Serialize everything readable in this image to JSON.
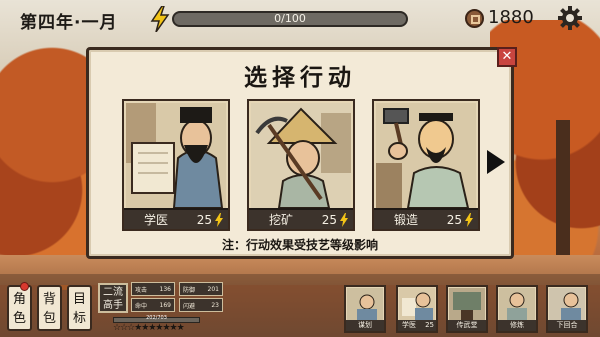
{
  "header": {
    "season": "第四年·一月",
    "energy_text": "0/100",
    "energy_fraction": 0,
    "coins": "1880"
  },
  "dialog": {
    "title": "选择行动",
    "close_label": "✕",
    "note": "注：行动效果受技艺等级影响",
    "cards": [
      {
        "name": "学医",
        "cost": "25"
      },
      {
        "name": "挖矿",
        "cost": "25"
      },
      {
        "name": "锻造",
        "cost": "25"
      }
    ]
  },
  "sidebar": {
    "buttons": [
      {
        "label_top": "角",
        "label_bottom": "色"
      },
      {
        "label_top": "背",
        "label_bottom": "包"
      },
      {
        "label_top": "目",
        "label_bottom": "标"
      }
    ]
  },
  "character": {
    "rank_top": "二流",
    "rank_bottom": "高手",
    "stats": [
      {
        "label": "攻击",
        "value": "136"
      },
      {
        "label": "防御",
        "value": "201"
      },
      {
        "label": "命中",
        "value": "169"
      },
      {
        "label": "闪避",
        "value": "23"
      }
    ],
    "xp_text": "202/703",
    "stars": "☆☆☆★★★★★★★"
  },
  "actions": [
    {
      "label": "谋划"
    },
    {
      "label": "学医",
      "cost": "25"
    },
    {
      "label": "传武堂"
    },
    {
      "label": "修炼"
    },
    {
      "label": "下回合"
    }
  ],
  "colors": {
    "panel": "#f3ead7",
    "dark": "#3c332c",
    "close": "#c9453f",
    "energy": "#f2c417"
  }
}
